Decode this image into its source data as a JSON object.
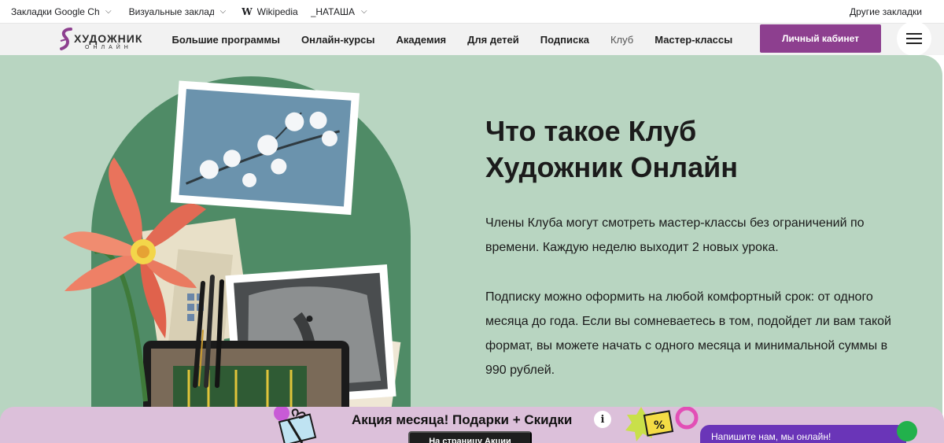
{
  "bookmarks": {
    "items": [
      {
        "label": "Закладки Google Chrome"
      },
      {
        "label": "Визуальные закладки"
      },
      {
        "label": "Wikipedia",
        "icon": "W"
      },
      {
        "label": "_НАТАША"
      }
    ],
    "other": "Другие закладки"
  },
  "header": {
    "logo_main": "ХУДОЖНИК",
    "logo_sub": "ОНЛАЙН",
    "nav": [
      "Большие программы",
      "Онлайн-курсы",
      "Академия",
      "Для детей",
      "Подписка",
      "Клуб",
      "Мастер-классы"
    ],
    "cabinet_label": "Личный кабинет"
  },
  "hero": {
    "title": "Что такое Клуб Художник Онлайн",
    "p1": "Члены Клуба могут смотреть мастер-классы без ограничений по времени. Каждую неделю выходит 2 новых урока.",
    "p2": "Подписку можно оформить на любой комфортный срок: от одного месяца до года. Если вы сомневаетесь в том, подойдет ли вам такой формат, вы можете начать с одного месяца и минимальной суммы в 990 рублей."
  },
  "promo": {
    "title": "Акция месяца! Подарки + Скидки",
    "info": "i",
    "button": "На страницу Акции",
    "chat": "Напишите нам, мы онлайн!"
  },
  "colors": {
    "accent": "#8d3f8f",
    "hero_bg": "#b8d5c1",
    "promo_bg": "#dcc0da",
    "chat_bg": "#6a35b8"
  }
}
